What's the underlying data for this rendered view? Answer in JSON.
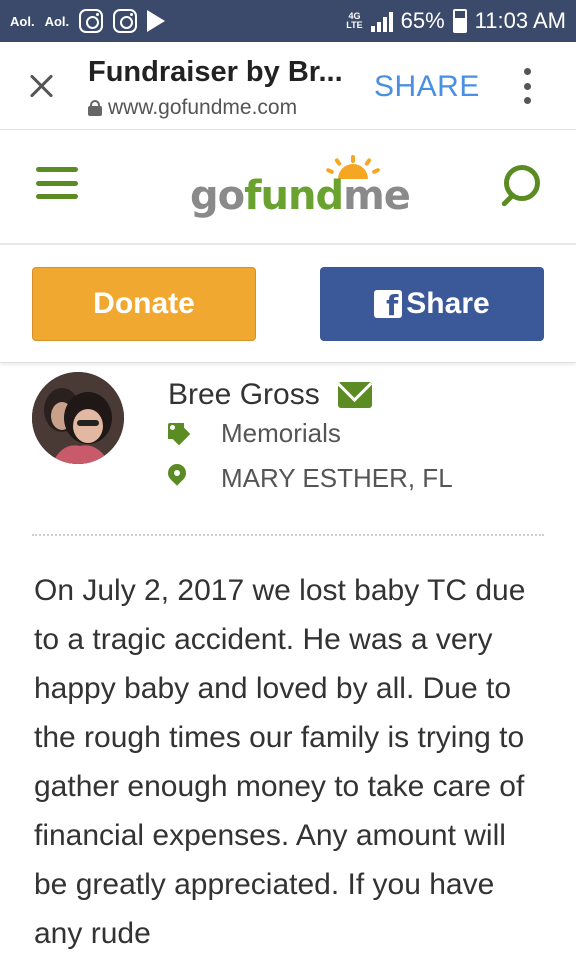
{
  "status_bar": {
    "left_apps": [
      "Aol.",
      "Aol."
    ],
    "network_top": "4G",
    "network_bottom": "LTE",
    "battery": "65%",
    "time": "11:03 AM"
  },
  "browser": {
    "title": "Fundraiser by Br...",
    "url": "www.gofundme.com",
    "share_label": "SHARE"
  },
  "site": {
    "logo_go": "go",
    "logo_fund": "fund",
    "logo_me": "me"
  },
  "actions": {
    "donate_label": "Donate",
    "share_label": "Share",
    "fb_glyph": "f"
  },
  "organizer": {
    "name": "Bree Gross",
    "category": "Memorials",
    "location": "MARY ESTHER, FL"
  },
  "story": {
    "text": "On July 2, 2017 we lost baby TC due to a tragic accident. He was a very happy baby and loved by all. Due to the rough times our family is trying to gather enough money to take care of financial expenses. Any amount will be greatly appreciated. If you have any rude"
  },
  "colors": {
    "status_bar_bg": "#3b4a6b",
    "brand_green": "#5b8c23",
    "donate_orange": "#f0a830",
    "facebook_blue": "#3b5998",
    "link_blue": "#4a90e2"
  }
}
